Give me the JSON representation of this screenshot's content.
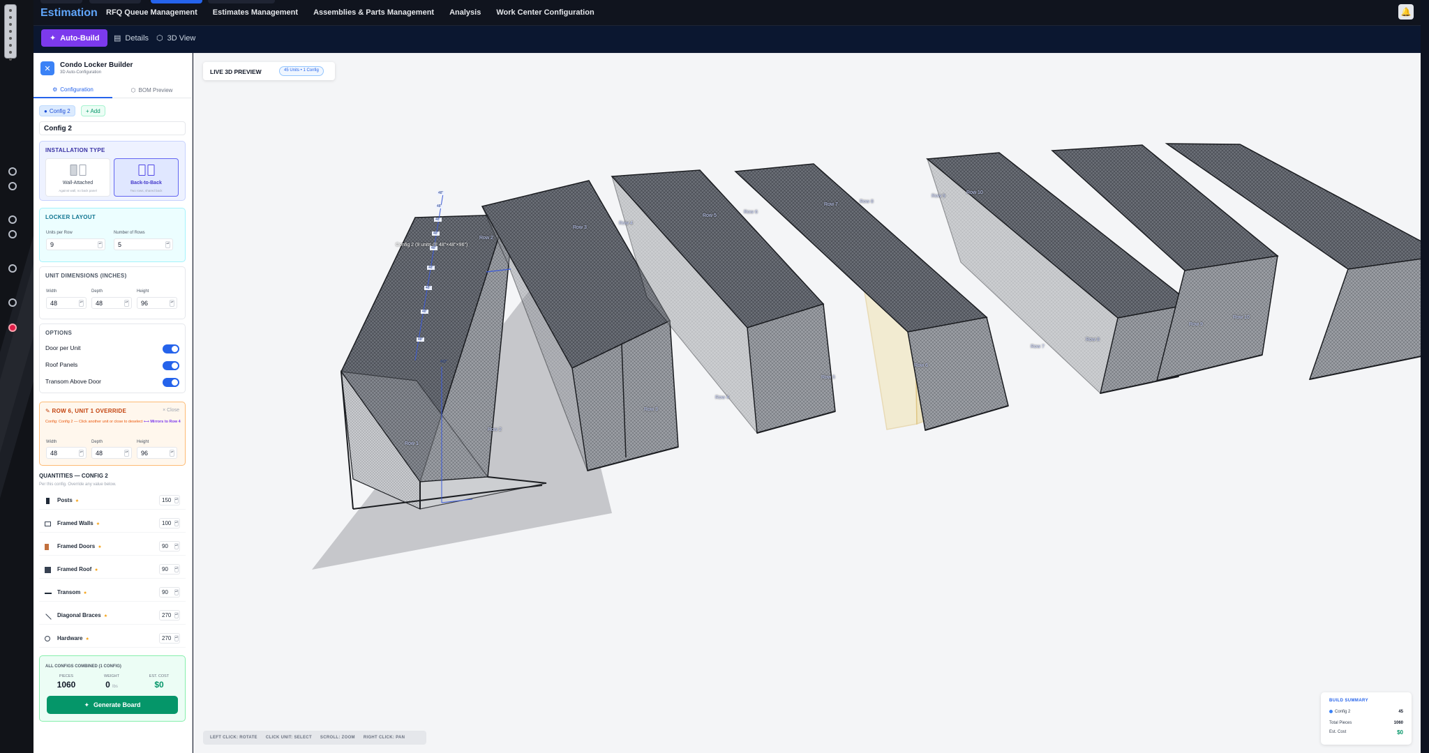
{
  "app": {
    "brand": "Estimation",
    "nav": [
      "RFQ Queue Management",
      "Estimates Management",
      "Assemblies & Parts Management",
      "Analysis",
      "Work Center Configuration"
    ]
  },
  "toolbar": {
    "buttons": [
      {
        "label": "Auto-Build",
        "icon": "magic-wand-icon",
        "active": true
      },
      {
        "label": "Details",
        "icon": "document-icon",
        "active": false
      },
      {
        "label": "3D View",
        "icon": "cube-icon",
        "active": false
      }
    ]
  },
  "panel": {
    "title": "Condo Locker Builder",
    "subtitle": "3D Auto-Configuration",
    "tabs": [
      "Configuration",
      "BOM Preview"
    ],
    "config_chip": "Config 2",
    "add_chip": "+ Add",
    "config_name": "Config 2",
    "installation": {
      "title": "INSTALLATION TYPE",
      "options": [
        {
          "label": "Wall-Attached",
          "desc": "Against wall, no back panel"
        },
        {
          "label": "Back-to-Back",
          "desc": "Two rows, shared back"
        }
      ],
      "selected": "Back-to-Back"
    },
    "layout": {
      "title": "LOCKER LAYOUT",
      "units_label": "Units per Row",
      "units": "9",
      "rows_label": "Number of Rows",
      "rows": "5"
    },
    "dimensions": {
      "title": "UNIT DIMENSIONS (INCHES)",
      "width_label": "Width",
      "width": "48",
      "depth_label": "Depth",
      "depth": "48",
      "height_label": "Height",
      "height": "96"
    },
    "options": {
      "title": "OPTIONS",
      "items": [
        {
          "label": "Door per Unit",
          "on": true
        },
        {
          "label": "Roof Panels",
          "on": true
        },
        {
          "label": "Transom Above Door",
          "on": true
        }
      ]
    },
    "override": {
      "title": "ROW 6, UNIT 1 OVERRIDE",
      "close": "× Close",
      "note": "Config: Config 2 — Click another unit or close to deselect",
      "link": "⟷ Mirrors to Row 4",
      "width_label": "Width",
      "width": "48",
      "depth_label": "Depth",
      "depth": "48",
      "height_label": "Height",
      "height": "96"
    },
    "quantities": {
      "title": "QUANTITIES — CONFIG 2",
      "subtitle": "Per this config. Override any value below.",
      "items": [
        {
          "label": "Posts",
          "value": "150",
          "icon": "post-icon"
        },
        {
          "label": "Framed Walls",
          "value": "100",
          "icon": "wall-icon"
        },
        {
          "label": "Framed Doors",
          "value": "90",
          "icon": "door-icon"
        },
        {
          "label": "Framed Roof",
          "value": "90",
          "icon": "roof-icon"
        },
        {
          "label": "Transom",
          "value": "90",
          "icon": "transom-icon"
        },
        {
          "label": "Diagonal Braces",
          "value": "270",
          "icon": "brace-icon"
        },
        {
          "label": "Hardware",
          "value": "270",
          "icon": "hardware-icon"
        }
      ]
    },
    "totals": {
      "title": "ALL CONFIGS COMBINED (1 CONFIG)",
      "pieces_label": "PIECES",
      "pieces": "1060",
      "weight_label": "WEIGHT",
      "weight": "0",
      "weight_unit": "lbs",
      "cost_label": "EST. COST",
      "cost": "$0",
      "button": "Generate Board"
    }
  },
  "preview": {
    "title": "LIVE 3D PREVIEW",
    "badge": "45 Units • 1 Config",
    "config_label": "Config 2 (9 units @ 48\"×48\"×96\")",
    "dim_labels": [
      "48\"",
      "48\"",
      "48\"",
      "48\"",
      "48\"",
      "48\"",
      "48\"",
      "48\"",
      "48\"",
      "48\"",
      "48\"",
      "48\"",
      "432\""
    ],
    "row_labels": [
      "Row 1",
      "Row 2",
      "Row 3",
      "Row 4",
      "Row 5",
      "Row 6",
      "Row 7",
      "Row 8",
      "Row 9",
      "Row 10"
    ],
    "hints": [
      "LEFT CLICK: ROTATE",
      "CLICK UNIT: SELECT",
      "SCROLL: ZOOM",
      "RIGHT CLICK: PAN"
    ],
    "summary": {
      "title": "BUILD SUMMARY",
      "config": "Config 2",
      "config_units": "45",
      "pieces_label": "Total Pieces",
      "pieces": "1060",
      "cost_label": "Est. Cost",
      "cost": "$0"
    }
  },
  "colors": {
    "accent": "#2563eb",
    "active_button": "#7c3aed",
    "generate": "#059669",
    "selected_unit": "#e5c46a"
  }
}
